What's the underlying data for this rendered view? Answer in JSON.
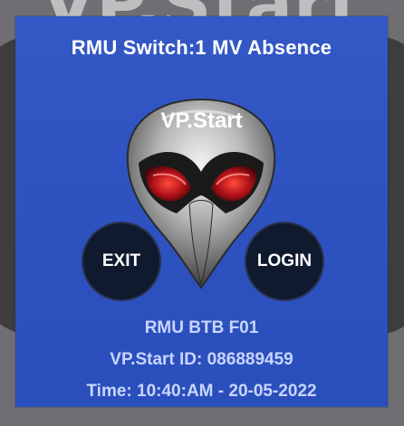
{
  "background": {
    "title": "VP.Start"
  },
  "dialog": {
    "title": "RMU Switch:1 MV Absence",
    "logo_text": "VP.Start",
    "mascot_icon": "alien-mask-icon",
    "exit_label": "EXIT",
    "login_label": "LOGIN",
    "device_name": "RMU BTB F01",
    "vp_id": "VP.Start ID: 086889459",
    "time": "Time: 10:40:AM - 20-05-2022"
  },
  "colors": {
    "dialog_bg": "#2e57c3",
    "button_bg": "#0f1a2f",
    "info_text": "#c9d5ff",
    "eye_red": "#d21b1b"
  }
}
